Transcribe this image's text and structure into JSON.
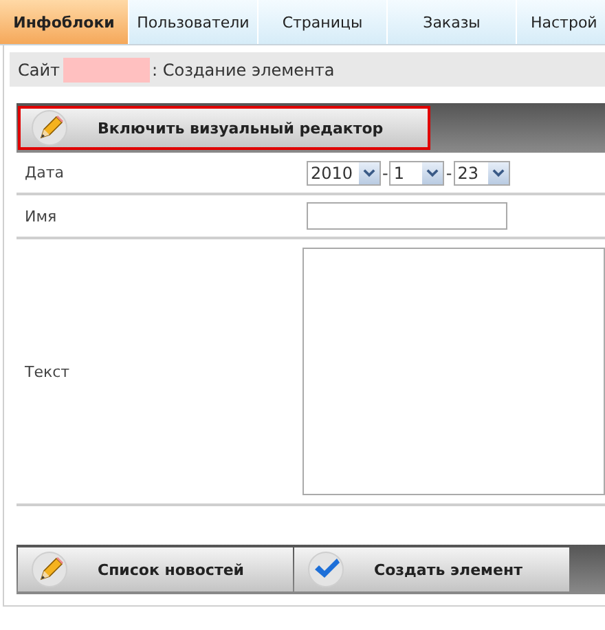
{
  "tabs": [
    {
      "label": "Инфоблоки",
      "selected": true
    },
    {
      "label": "Пользователи",
      "selected": false
    },
    {
      "label": "Страницы",
      "selected": false
    },
    {
      "label": "Заказы",
      "selected": false
    },
    {
      "label": "Настрой",
      "selected": false
    }
  ],
  "heading": {
    "prefix": "Сайт",
    "suffix": ": Создание элемента"
  },
  "editor_button": {
    "label": "Включить визуальный редактор",
    "highlighted": true
  },
  "fields": [
    {
      "kind": "date",
      "label": "Дата",
      "year": "2010",
      "separator_1": "-",
      "month": "1",
      "separator_2": "-",
      "day": "23"
    },
    {
      "kind": "text",
      "label": "Имя"
    },
    {
      "kind": "textarea",
      "label": "Текст"
    }
  ],
  "actions": [
    {
      "kind": "pencil",
      "label": "Список новостей"
    },
    {
      "kind": "check",
      "label": "Создать элемент"
    }
  ]
}
